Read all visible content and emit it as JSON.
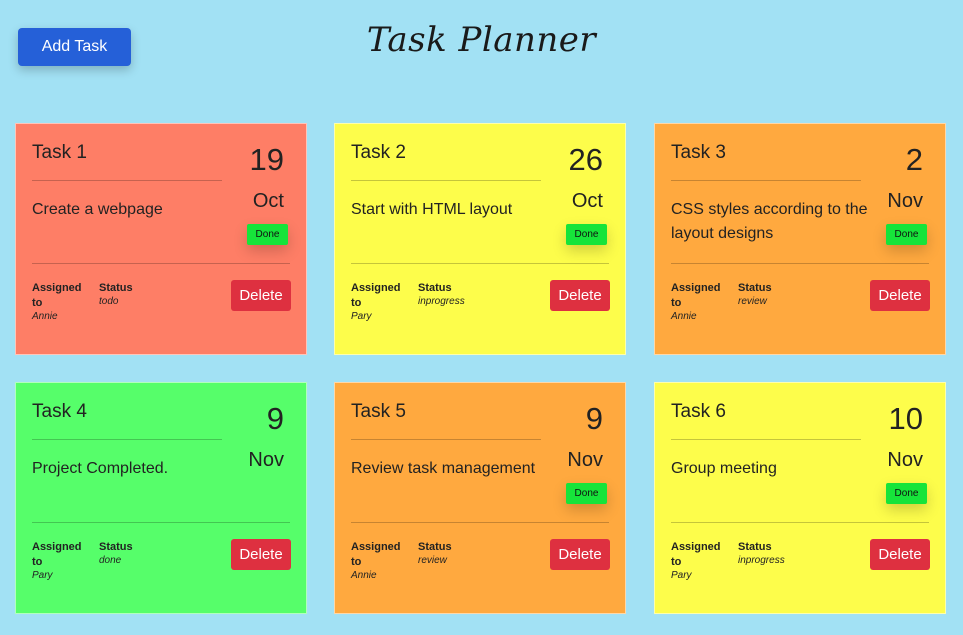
{
  "header": {
    "add_task_label": "Add Task",
    "title": "Task Planner"
  },
  "labels": {
    "assigned": "Assigned to",
    "status": "Status",
    "done": "Done",
    "delete": "Delete"
  },
  "tasks": [
    {
      "title": "Task 1",
      "description": "Create a webpage",
      "day": "19",
      "month": "Oct",
      "assigned": "Annie",
      "status": "todo",
      "has_done_button": true,
      "color": "#fe7e66"
    },
    {
      "title": "Task 2",
      "description": "Start with HTML layout",
      "day": "26",
      "month": "Oct",
      "assigned": "Pary",
      "status": "inprogress",
      "has_done_button": true,
      "color": "#fdfd4b"
    },
    {
      "title": "Task 3",
      "description": "CSS styles according to the layout designs",
      "day": "2",
      "month": "Nov",
      "assigned": "Annie",
      "status": "review",
      "has_done_button": true,
      "color": "#ffa93f"
    },
    {
      "title": "Task 4",
      "description": "Project Completed.",
      "day": "9",
      "month": "Nov",
      "assigned": "Pary",
      "status": "done",
      "has_done_button": false,
      "color": "#56fe6a"
    },
    {
      "title": "Task 5",
      "description": "Review task management",
      "day": "9",
      "month": "Nov",
      "assigned": "Annie",
      "status": "review",
      "has_done_button": true,
      "color": "#ffa93f"
    },
    {
      "title": "Task 6",
      "description": "Group meeting",
      "day": "10",
      "month": "Nov",
      "assigned": "Pary",
      "status": "inprogress",
      "has_done_button": true,
      "color": "#fdfd4b"
    }
  ]
}
